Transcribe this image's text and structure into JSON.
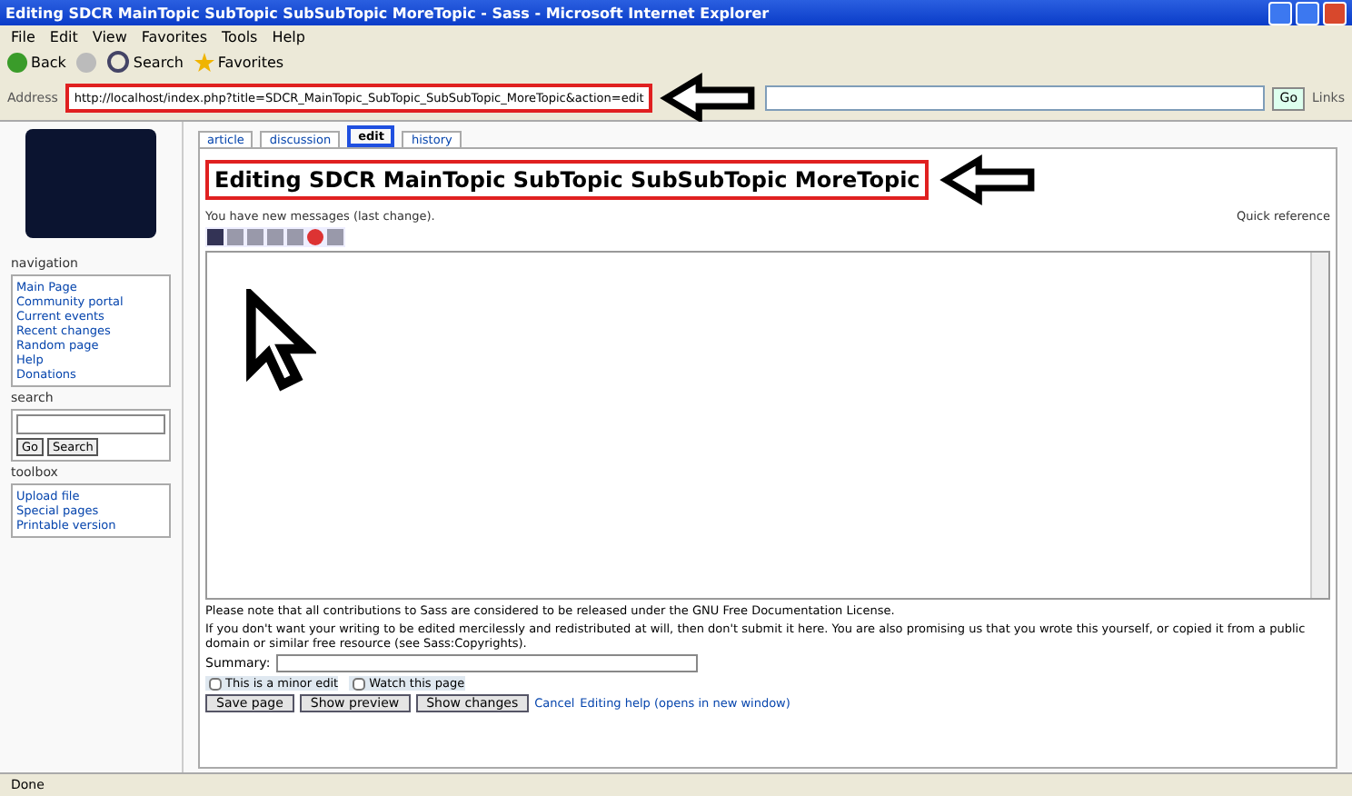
{
  "window": {
    "title": "Editing SDCR MainTopic SubTopic SubSubTopic MoreTopic - Sass - Microsoft Internet Explorer"
  },
  "menu": [
    "File",
    "Edit",
    "View",
    "Favorites",
    "Tools",
    "Help"
  ],
  "toolbar": [
    {
      "kind": "back",
      "label": "Back"
    },
    {
      "kind": "forward"
    },
    {
      "kind": "search",
      "label": "Search"
    },
    {
      "kind": "favorites",
      "label": "Favorites"
    }
  ],
  "address": {
    "label": "Address",
    "value": "http://localhost/index.php?title=SDCR_MainTopic_SubTopic_SubSubTopic_MoreTopic&action=edit",
    "go": "Go",
    "links": "Links"
  },
  "tabs": [
    {
      "label": "article",
      "selected": false
    },
    {
      "label": "discussion",
      "selected": false
    },
    {
      "label": "edit",
      "selected": true
    },
    {
      "label": "history",
      "selected": false
    }
  ],
  "heading": "Editing SDCR MainTopic SubTopic SubSubTopic MoreTopic",
  "notice": "You have new messages (last change).",
  "side_notice": "Quick reference",
  "sidebar": [
    {
      "title": "navigation",
      "items": [
        "Main Page",
        "Community portal",
        "Current events",
        "Recent changes",
        "Random page",
        "Help",
        "Donations"
      ]
    },
    {
      "title": "search",
      "search_buttons": [
        "Go",
        "Search"
      ]
    },
    {
      "title": "toolbox",
      "items": [
        "Upload file",
        "Special pages",
        "Printable version"
      ]
    }
  ],
  "footer_text": [
    "Please note that all contributions to Sass are considered to be released under the GNU Free Documentation License.",
    "If you don't want your writing to be edited mercilessly and redistributed at will, then don't submit it here. You are also promising us that you wrote this yourself, or copied it from a public domain or similar free resource (see Sass:Copyrights)."
  ],
  "summary": {
    "label": "Summary:"
  },
  "checkboxes": [
    {
      "label": "This is a minor edit",
      "checked": false
    },
    {
      "label": "Watch this page",
      "checked": false
    }
  ],
  "buttons": [
    "Save page",
    "Show preview",
    "Show changes"
  ],
  "cancel": "Cancel",
  "help_link": "Editing help (opens in new window)",
  "status_bar": "Done"
}
